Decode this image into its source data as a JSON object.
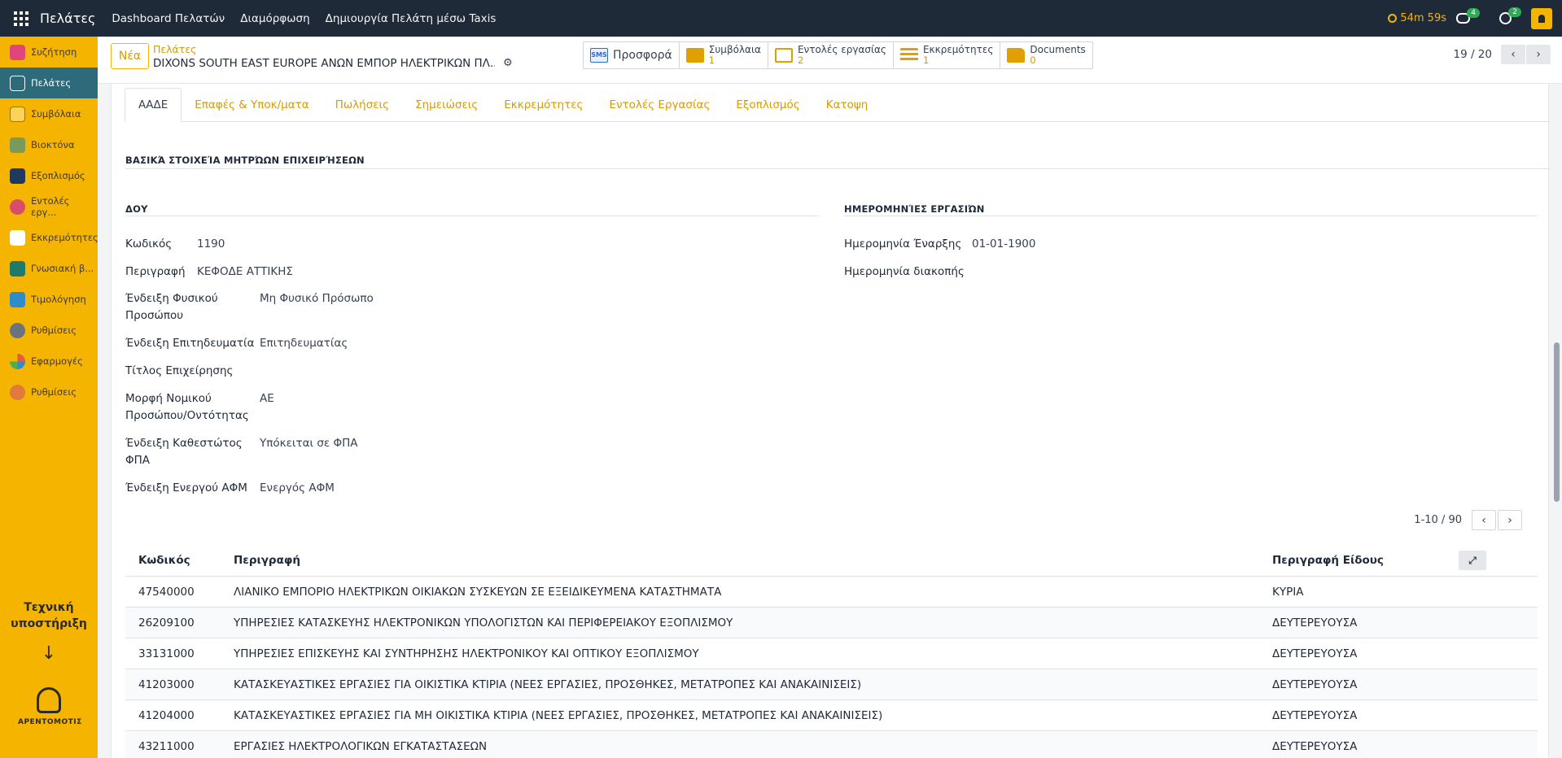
{
  "topbar": {
    "app_title": "Πελάτες",
    "menu": [
      "Dashboard Πελατών",
      "Διαμόρφωση",
      "Δημιουργία Πελάτη μέσω Taxis"
    ],
    "timer": "54m 59s",
    "chat_count": "4",
    "activity_count": "2"
  },
  "sidebar": {
    "items": [
      {
        "label": "Συζήτηση",
        "icon": "chat-icon",
        "color": "#e0457b"
      },
      {
        "label": "Πελάτες",
        "icon": "customers-icon",
        "color": "#2d6a7a"
      },
      {
        "label": "Συμβόλαια",
        "icon": "contracts-icon",
        "color": "#f5b400"
      },
      {
        "label": "Βιοκτόνα",
        "icon": "biocide-icon",
        "color": "#4caf50"
      },
      {
        "label": "Εξοπλισμός",
        "icon": "equipment-icon",
        "color": "#1e3a5f"
      },
      {
        "label": "Εντολές εργ...",
        "icon": "work-orders-icon",
        "color": "#d84d6c"
      },
      {
        "label": "Εκκρεμότητες",
        "icon": "pending-icon",
        "color": "#ffffff"
      },
      {
        "label": "Γνωσιακή β...",
        "icon": "knowledge-icon",
        "color": "#1e7a6a"
      },
      {
        "label": "Τιμολόγηση",
        "icon": "invoicing-icon",
        "color": "#2d8cc9"
      },
      {
        "label": "Ρυθμίσεις",
        "icon": "settings-icon",
        "color": "#6b7280"
      },
      {
        "label": "Εφαρμογές",
        "icon": "apps-icon",
        "color": "#e35d3d"
      },
      {
        "label": "Ρυθμίσεις",
        "icon": "settings-alt-icon",
        "color": "#e07a3d"
      }
    ],
    "support_text": "Τεχνική υποστήριξη",
    "logo_text": "ΑΡΕΝΤΟΜΟΤΙΣ"
  },
  "control": {
    "new_label": "Νέα",
    "breadcrumb_parent": "Πελάτες",
    "breadcrumb_current": "DIXONS SOUTH EAST EUROPE ΑΝΩΝ ΕΜΠΟΡ ΗΛΕΚΤΡΙΚΩΝ ΠΛ...",
    "smart_buttons": [
      {
        "label": "Προσφορά",
        "value": ""
      },
      {
        "label": "Συμβόλαια",
        "value": "1"
      },
      {
        "label": "Εντολές εργασίας",
        "value": "2"
      },
      {
        "label": "Εκκρεμότητες",
        "value": "1"
      },
      {
        "label": "Documents",
        "value": "0"
      }
    ],
    "sms_label": "SMS",
    "pager": "19 / 20"
  },
  "tabs": [
    "ΑΑΔΕ",
    "Επαφές & Υποκ/ματα",
    "Πωλήσεις",
    "Σημειώσεις",
    "Εκκρεμότητες",
    "Εντολές Εργασίας",
    "Εξοπλισμός",
    "Κατοψη"
  ],
  "form": {
    "main_section": "ΒΑΣΙΚΆ ΣΤΟΙΧΕΊΑ ΜΗΤΡΏΩΝ ΕΠΙΧΕΙΡΉΣΕΩΝ",
    "doy_section": "ΔΟΥ",
    "dates_section": "ΗΜΕΡΟΜΗΝΊΕΣ ΕΡΓΑΣΙΏΝ",
    "code_label": "Κωδικός",
    "code_value": "1190",
    "desc_label": "Περιγραφή",
    "desc_value": "ΚΕΦΟΔΕ ΑΤΤΙΚΗΣ",
    "natural_label": "Ένδειξη Φυσικού Προσώπου",
    "natural_value": "Μη Φυσικό Πρόσωπο",
    "business_label": "Ένδειξη Επιτηδευματία",
    "business_value": "Επιτηδευματίας",
    "title_label": "Τίτλος Επιχείρησης",
    "title_value": "",
    "legal_label": "Μορφή Νομικού Προσώπου/Οντότητας",
    "legal_value": "ΑΕ",
    "vat_label": "Ένδειξη Καθεστώτος ΦΠΑ",
    "vat_value": "Υπόκειται σε ΦΠΑ",
    "active_label": "Ένδειξη Ενεργού ΑΦΜ",
    "active_value": "Ενεργός ΑΦΜ",
    "start_label": "Ημερομηνία Έναρξης",
    "start_value": "01-01-1900",
    "stop_label": "Ημερομηνία διακοπής",
    "stop_value": ""
  },
  "table": {
    "pager": "1-10 / 90",
    "headers": [
      "Κωδικός",
      "Περιγραφή",
      "Περιγραφή Είδους"
    ],
    "rows": [
      [
        "47540000",
        "ΛΙΑΝΙΚΟ ΕΜΠΟΡΙΟ ΗΛΕΚΤΡΙΚΩΝ ΟΙΚΙΑΚΩΝ ΣΥΣΚΕΥΩΝ ΣΕ ΕΞΕΙΔΙΚΕΥΜΕΝΑ ΚΑΤΑΣΤΗΜΑΤΑ",
        "ΚΥΡΙΑ"
      ],
      [
        "26209100",
        "ΥΠΗΡΕΣΙΕΣ ΚΑΤΑΣΚΕΥΗΣ ΗΛΕΚΤΡΟΝΙΚΩΝ ΥΠΟΛΟΓΙΣΤΩΝ ΚΑΙ ΠΕΡΙΦΕΡΕΙΑΚΟΥ ΕΞΟΠΛΙΣΜΟΥ",
        "ΔΕΥΤΕΡΕΥΟΥΣΑ"
      ],
      [
        "33131000",
        "ΥΠΗΡΕΣΙΕΣ ΕΠΙΣΚΕΥΗΣ ΚΑΙ ΣΥΝΤΗΡΗΣΗΣ ΗΛΕΚΤΡΟΝΙΚΟΥ ΚΑΙ ΟΠΤΙΚΟΥ ΕΞΟΠΛΙΣΜΟΥ",
        "ΔΕΥΤΕΡΕΥΟΥΣΑ"
      ],
      [
        "41203000",
        "ΚΑΤΑΣΚΕΥΑΣΤΙΚΕΣ ΕΡΓΑΣΙΕΣ ΓΙΑ ΟΙΚΙΣΤΙΚΑ ΚΤΙΡΙΑ (ΝΕΕΣ ΕΡΓΑΣΙΕΣ, ΠΡΟΣΘΗΚΕΣ, ΜΕΤΑΤΡΟΠΕΣ ΚΑΙ ΑΝΑΚΑΙΝΙΣΕΙΣ)",
        "ΔΕΥΤΕΡΕΥΟΥΣΑ"
      ],
      [
        "41204000",
        "ΚΑΤΑΣΚΕΥΑΣΤΙΚΕΣ ΕΡΓΑΣΙΕΣ ΓΙΑ ΜΗ ΟΙΚΙΣΤΙΚΑ ΚΤΙΡΙΑ (ΝΕΕΣ ΕΡΓΑΣΙΕΣ, ΠΡΟΣΘΗΚΕΣ, ΜΕΤΑΤΡΟΠΕΣ ΚΑΙ ΑΝΑΚΑΙΝΙΣΕΙΣ)",
        "ΔΕΥΤΕΡΕΥΟΥΣΑ"
      ],
      [
        "43211000",
        "ΕΡΓΑΣΙΕΣ ΗΛΕΚΤΡΟΛΟΓΙΚΩΝ ΕΓΚΑΤΑΣΤΑΣΕΩΝ",
        "ΔΕΥΤΕΡΕΥΟΥΣΑ"
      ]
    ]
  }
}
